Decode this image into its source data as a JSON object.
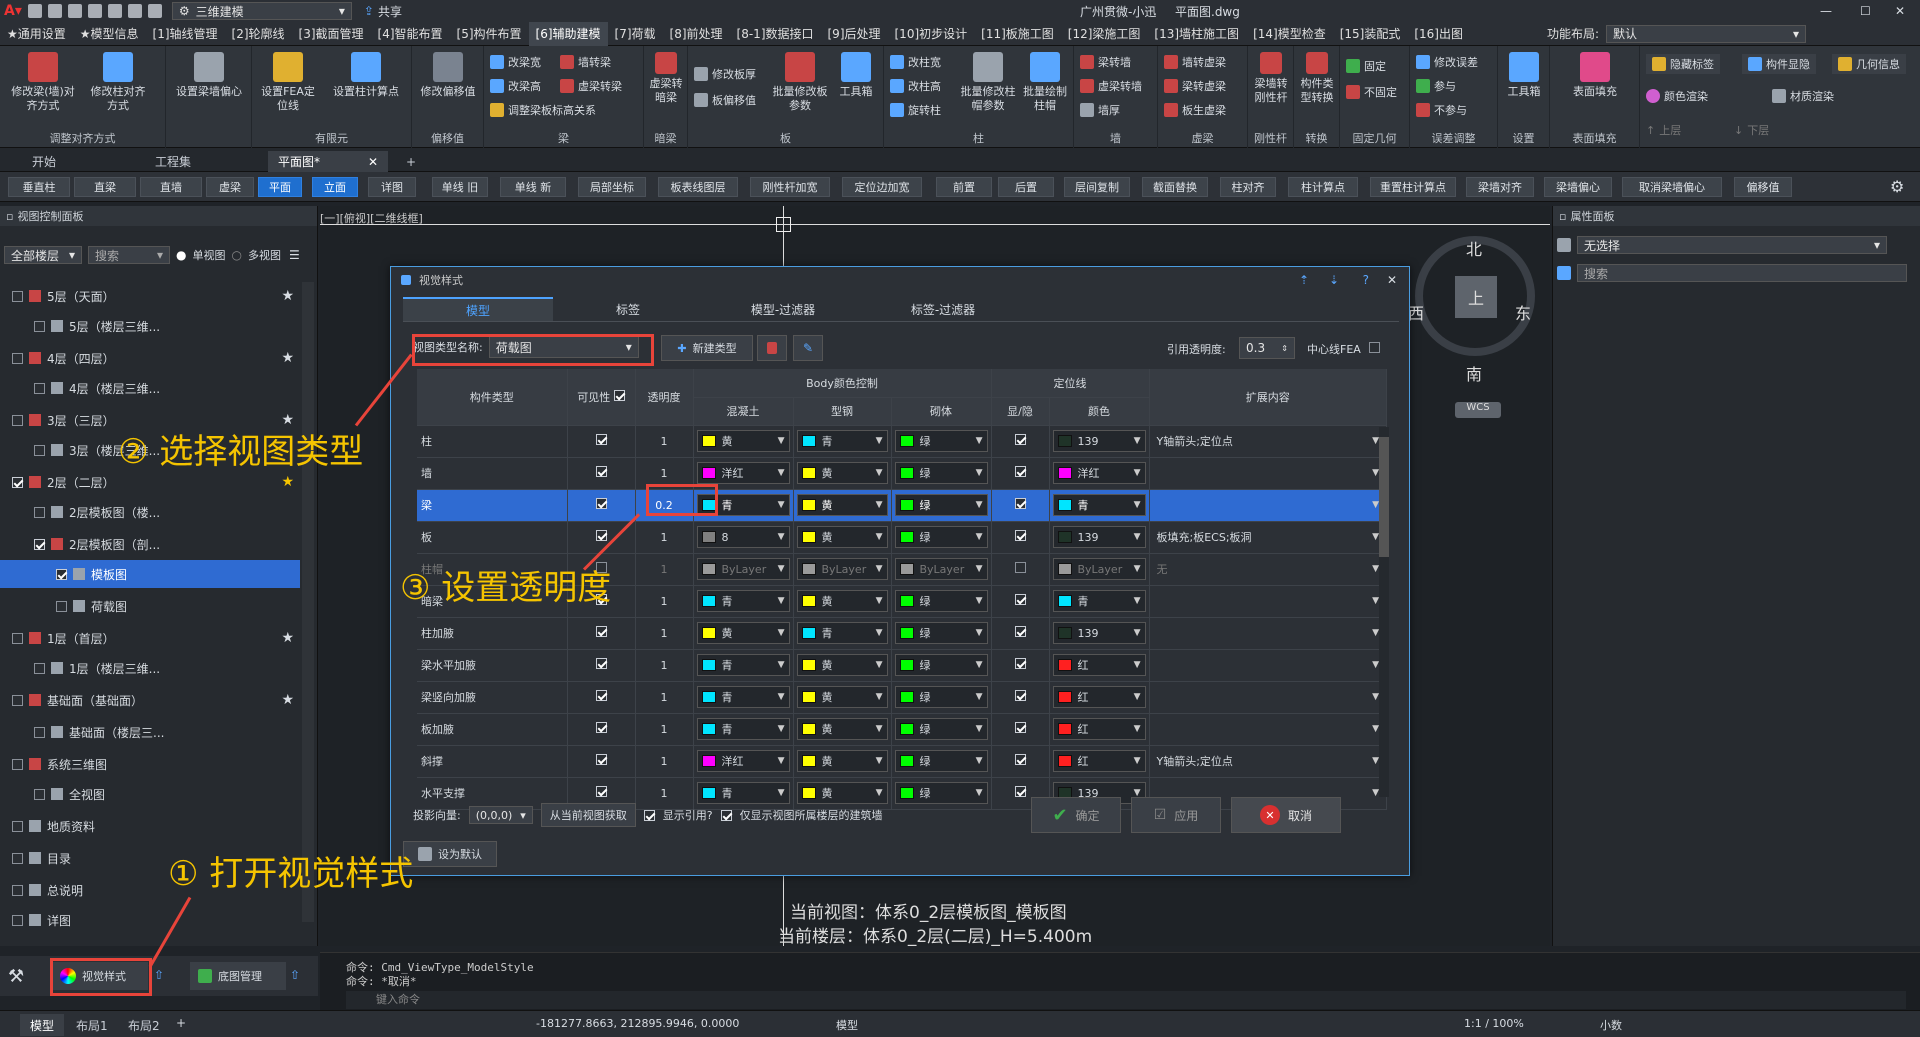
{
  "titlebar": {
    "workspace": "三维建模",
    "share": "共享",
    "center_title": "广州贯微-小迅",
    "file": "平面图.dwg"
  },
  "menu": [
    "★通用设置",
    "★模型信息",
    "[1]轴线管理",
    "[2]轮廓线",
    "[3]截面管理",
    "[4]智能布置",
    "[5]构件布置",
    "[6]辅助建模",
    "[7]荷载",
    "[8]前处理",
    "[8-1]数据接口",
    "[9]后处理",
    "[10]初步设计",
    "[11]板施工图",
    "[12]梁施工图",
    "[13]墙柱施工图",
    "[14]模型检查",
    "[15]装配式",
    "[16]出图",
    "功能布局:",
    "默认"
  ],
  "ribbon": {
    "groups": [
      {
        "label": "调整对齐方式",
        "buttons": [
          "修改梁(墙)对齐方式",
          "修改柱对齐方式",
          "设置梁墙偏心"
        ]
      },
      {
        "label": "有限元",
        "buttons": [
          "设置FEA定位线",
          "设置柱计算点"
        ]
      },
      {
        "label": "偏移值",
        "buttons": [
          "修改偏移值"
        ]
      },
      {
        "label": "梁",
        "buttons": [
          "改梁宽",
          "改梁高",
          "调整梁板标高关系",
          "墙转梁",
          "虚梁转梁"
        ]
      },
      {
        "label": "暗梁",
        "buttons": [
          "虚梁转暗梁"
        ]
      },
      {
        "label": "板",
        "buttons": [
          "修改板厚",
          "板偏移值",
          "批量修改板参数",
          "工具箱"
        ]
      },
      {
        "label": "柱",
        "buttons": [
          "改柱宽",
          "改柱高",
          "旋转柱",
          "批量修改柱帽参数",
          "批量绘制柱帽"
        ]
      },
      {
        "label": "墙",
        "buttons": [
          "梁转墙",
          "虚梁转墙",
          "墙厚"
        ]
      },
      {
        "label": "虚梁",
        "buttons": [
          "墙转虚梁",
          "梁转虚梁",
          "板生虚梁"
        ]
      },
      {
        "label": "刚性杆",
        "buttons": [
          "梁墙转刚性杆"
        ]
      },
      {
        "label": "转换",
        "buttons": [
          "构件类型转换"
        ]
      },
      {
        "label": "固定几何",
        "buttons": [
          "固定",
          "不固定"
        ]
      },
      {
        "label": "误差调整",
        "buttons": [
          "修改误差",
          "参与",
          "不参与"
        ]
      },
      {
        "label": "设置",
        "buttons": [
          "工具箱"
        ]
      },
      {
        "label": "表面填充",
        "buttons": [
          "表面填充"
        ]
      }
    ],
    "right": [
      "隐藏标签",
      "构件显隐",
      "几何信息",
      "颜色渲染",
      "材质渲染",
      "上层",
      "下层"
    ]
  },
  "doctabs": [
    "开始",
    "工程集",
    "平面图*"
  ],
  "quickbar": [
    "垂直柱",
    "直梁",
    "直墙",
    "虚梁",
    "平面",
    "立面",
    "详图",
    "单线 旧",
    "单线 新",
    "局部坐标",
    "板表线图层",
    "刚性杆加宽",
    "定位边加宽",
    "前置",
    "后置",
    "层间复制",
    "截面替换",
    "柱对齐",
    "柱计算点",
    "重置柱计算点",
    "梁墙对齐",
    "梁墙偏心",
    "取消梁墙偏心",
    "偏移值"
  ],
  "leftpanel": {
    "title": "视图控制面板",
    "floor_select": "全部楼层",
    "search": "搜索",
    "radio1": "单视图",
    "radio2": "多视图",
    "tree": [
      "5层（天面）",
      "5层（楼层三维...",
      "4层（四层）",
      "4层（楼层三维...",
      "3层（三层）",
      "3层（楼层三维...",
      "2层（二层）",
      "2层模板图（楼...",
      "2层模板图（剖...",
      "模板图",
      "荷载图",
      "1层（首层）",
      "1层（楼层三维...",
      "基础面（基础面）",
      "基础面（楼层三...",
      "系统三维图",
      "全视图",
      "地质资料",
      "目录",
      "总说明",
      "详图"
    ],
    "bottom_btn1": "视觉样式",
    "bottom_btn2": "底图管理"
  },
  "canvas": {
    "label": "[一][俯视][二维线框]",
    "compass": {
      "n": "北",
      "s": "南",
      "e": "东",
      "w": "西",
      "center": "上",
      "wcs": "WCS"
    },
    "view_line1": "当前视图：体系0_2层模板图_模板图",
    "view_line2": "当前楼层：体系0_2层(二层)_H=5.400m"
  },
  "rightpanel": {
    "title": "属性面板",
    "selection": "无选择",
    "search": "搜索"
  },
  "dialog": {
    "title": "视觉样式",
    "tabs": [
      "模型",
      "标签",
      "模型-过滤器",
      "标签-过滤器"
    ],
    "view_type_label": "视图类型名称:",
    "view_type_value": "荷载图",
    "new_type": "新建类型",
    "ref_transparency_label": "引用透明度:",
    "ref_transparency": "0.3",
    "center_fea": "中心线FEA",
    "headers": {
      "type": "构件类型",
      "visible": "可见性",
      "transparency": "透明度",
      "body": "Body颜色控制",
      "concrete": "混凝土",
      "steel": "型钢",
      "masonry": "砌体",
      "locline": "定位线",
      "show": "显/隐",
      "color": "颜色",
      "ext": "扩展内容"
    },
    "rows": [
      {
        "name": "柱",
        "t": "1",
        "c": "黄",
        "s": "青",
        "m": "绿",
        "lc": "139",
        "ext": "Y轴箭头;定位点"
      },
      {
        "name": "墙",
        "t": "1",
        "c": "洋红",
        "s": "黄",
        "m": "绿",
        "lc": "洋红",
        "ext": ""
      },
      {
        "name": "梁",
        "t": "0.2",
        "c": "青",
        "s": "黄",
        "m": "绿",
        "lc": "青",
        "ext": ""
      },
      {
        "name": "板",
        "t": "1",
        "c": "8",
        "s": "黄",
        "m": "绿",
        "lc": "139",
        "ext": "板填充;板ECS;板洞"
      },
      {
        "name": "柱帽",
        "t": "1",
        "c": "ByLayer",
        "s": "ByLayer",
        "m": "ByLayer",
        "lc": "ByLayer",
        "ext": "无"
      },
      {
        "name": "暗梁",
        "t": "1",
        "c": "青",
        "s": "黄",
        "m": "绿",
        "lc": "青",
        "ext": ""
      },
      {
        "name": "柱加腋",
        "t": "1",
        "c": "黄",
        "s": "青",
        "m": "绿",
        "lc": "139",
        "ext": ""
      },
      {
        "name": "梁水平加腋",
        "t": "1",
        "c": "青",
        "s": "黄",
        "m": "绿",
        "lc": "红",
        "ext": ""
      },
      {
        "name": "梁竖向加腋",
        "t": "1",
        "c": "青",
        "s": "黄",
        "m": "绿",
        "lc": "红",
        "ext": ""
      },
      {
        "name": "板加腋",
        "t": "1",
        "c": "青",
        "s": "黄",
        "m": "绿",
        "lc": "红",
        "ext": ""
      },
      {
        "name": "斜撑",
        "t": "1",
        "c": "洋红",
        "s": "黄",
        "m": "绿",
        "lc": "红",
        "ext": "Y轴箭头;定位点"
      },
      {
        "name": "水平支撑",
        "t": "1",
        "c": "青",
        "s": "黄",
        "m": "绿",
        "lc": "139",
        "ext": ""
      }
    ],
    "proj_label": "投影向量:",
    "proj_value": "(0,0,0)",
    "from_view": "从当前视图获取",
    "show_ref": "显示引用?",
    "only_floor": "仅显示视图所属楼层的建筑墙",
    "ok": "确定",
    "apply": "应用",
    "cancel": "取消",
    "set_default": "设为默认"
  },
  "annotations": {
    "step1": "① 打开视觉样式",
    "step2": "② 选择视图类型",
    "step3": "③ 设置透明度"
  },
  "command": {
    "line1": "命令: Cmd_ViewType_ModelStyle",
    "line2": "命令: *取消*",
    "prompt": "键入命令"
  },
  "status": {
    "tabs": [
      "模型",
      "布局1",
      "布局2"
    ],
    "coords": "-181277.8663, 212895.9946, 0.0000",
    "model": "模型",
    "scale": "1:1 / 100%",
    "decimal": "小数"
  },
  "colors": {
    "黄": "#ffff00",
    "青": "#00e5ff",
    "绿": "#00ff00",
    "洋红": "#ff00ff",
    "红": "#ff2020",
    "8": "#808080",
    "139": "#1f3328",
    "ByLayer": "#9a9a9a",
    "accent": "#2f6bd2",
    "annotation": "#f5c400",
    "highlight": "#e8443a"
  }
}
